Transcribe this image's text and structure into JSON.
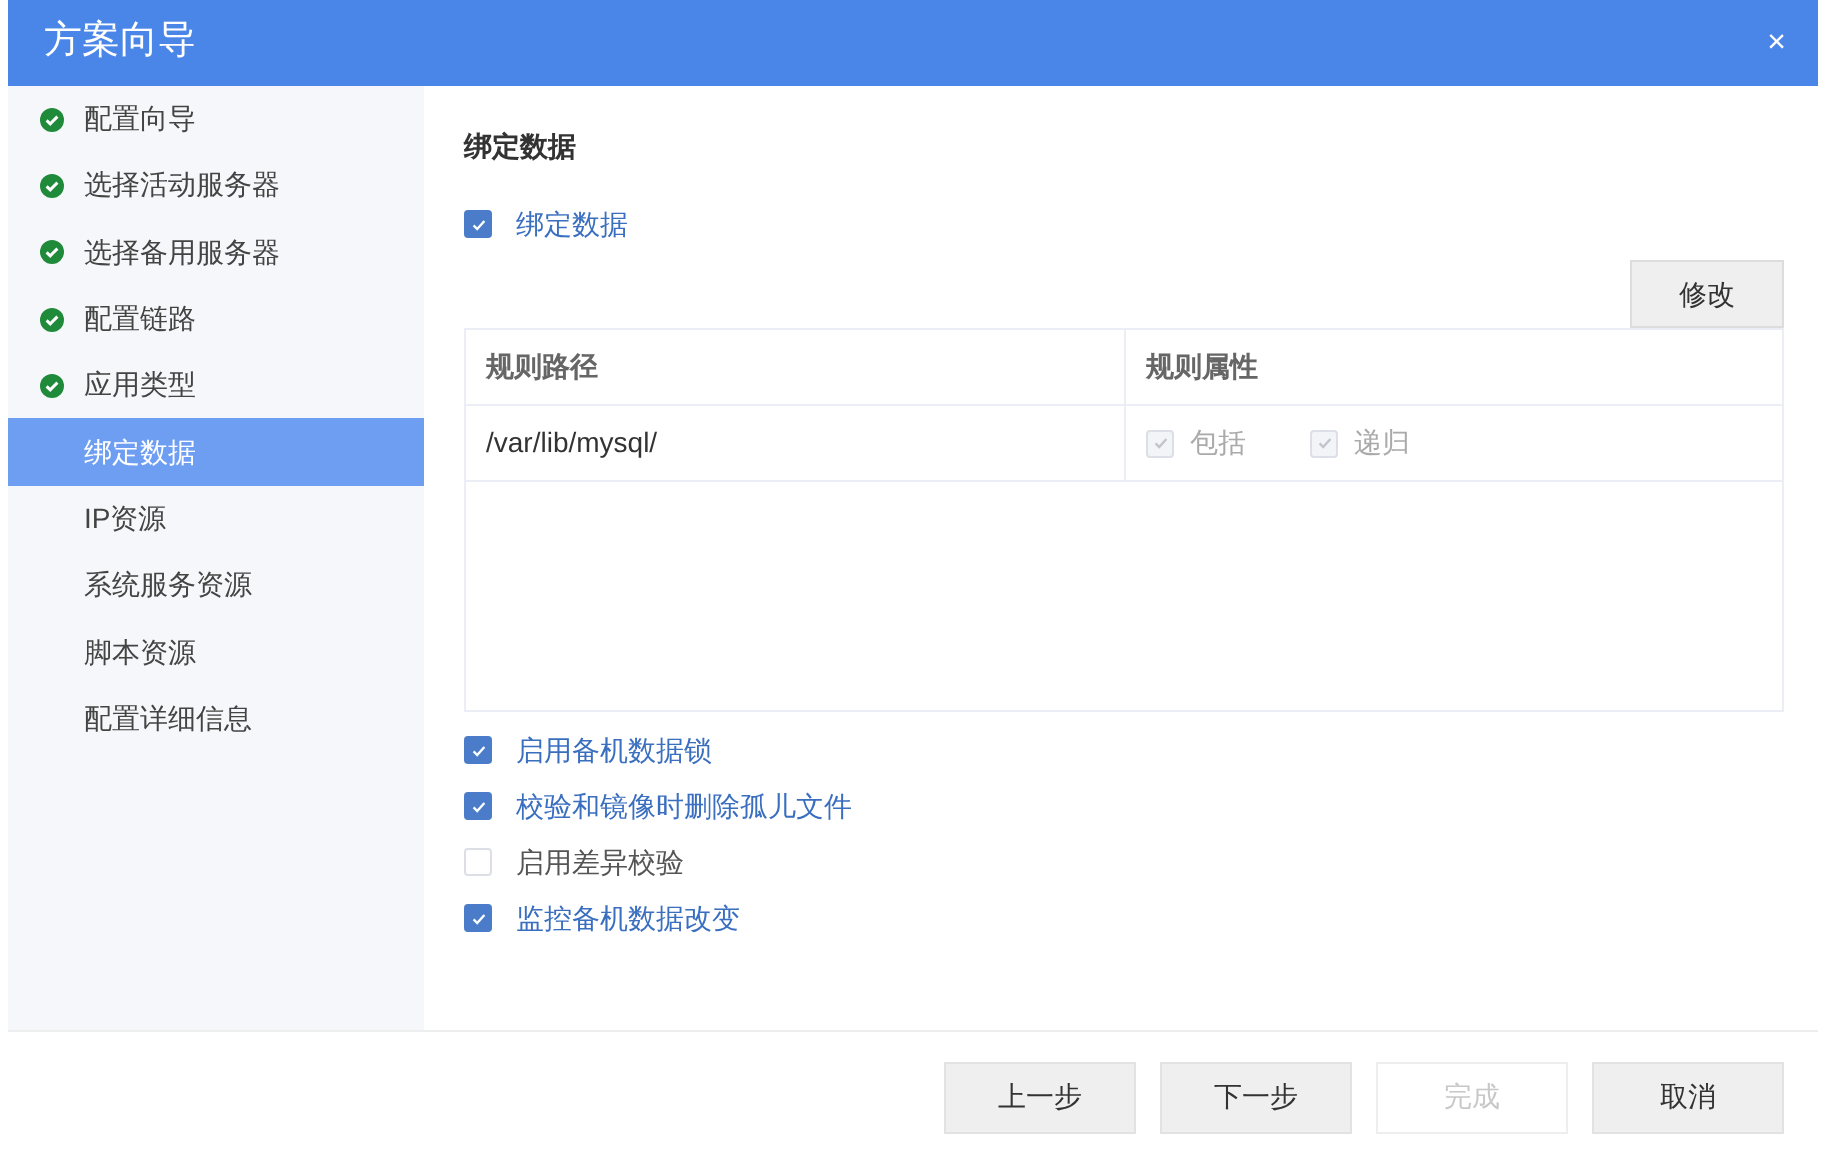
{
  "window": {
    "title": "方案向导",
    "close": "×"
  },
  "sidebar": {
    "items": [
      {
        "label": "配置向导",
        "done": true,
        "selected": false
      },
      {
        "label": "选择活动服务器",
        "done": true,
        "selected": false
      },
      {
        "label": "选择备用服务器",
        "done": true,
        "selected": false
      },
      {
        "label": "配置链路",
        "done": true,
        "selected": false
      },
      {
        "label": "应用类型",
        "done": true,
        "selected": false
      },
      {
        "label": "绑定数据",
        "done": false,
        "selected": true
      },
      {
        "label": "IP资源",
        "done": false,
        "selected": false
      },
      {
        "label": "系统服务资源",
        "done": false,
        "selected": false
      },
      {
        "label": "脚本资源",
        "done": false,
        "selected": false
      },
      {
        "label": "配置详细信息",
        "done": false,
        "selected": false
      }
    ]
  },
  "section_title": "绑定数据",
  "bind_checkbox": {
    "label": "绑定数据",
    "checked": true
  },
  "edit_button": "修改",
  "table": {
    "columns": [
      "规则路径",
      "规则属性"
    ],
    "rows": [
      {
        "path": "/var/lib/mysql/",
        "attributes": [
          {
            "label": "包括",
            "checked": true,
            "disabled": true
          },
          {
            "label": "递归",
            "checked": true,
            "disabled": true
          }
        ]
      }
    ]
  },
  "options": [
    {
      "label": "启用备机数据锁",
      "checked": true
    },
    {
      "label": "校验和镜像时删除孤儿文件",
      "checked": true
    },
    {
      "label": "启用差异校验",
      "checked": false
    },
    {
      "label": "监控备机数据改变",
      "checked": true
    }
  ],
  "footer_buttons": [
    {
      "label": "上一步",
      "disabled": false
    },
    {
      "label": "下一步",
      "disabled": false
    },
    {
      "label": "完成",
      "disabled": true
    },
    {
      "label": "取消",
      "disabled": false
    }
  ]
}
